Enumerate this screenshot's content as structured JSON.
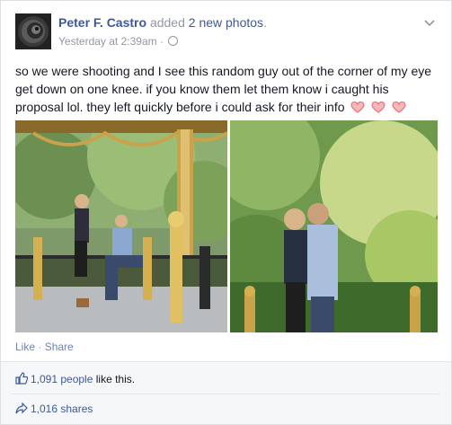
{
  "post": {
    "author": "Peter F. Castro",
    "action_prefix": "added",
    "action_link": "2 new photos",
    "action_suffix": ".",
    "timestamp": "Yesterday at 2:39am",
    "separator": "·",
    "privacy_icon": "globe-icon",
    "menu_icon": "chevron-down-icon",
    "message": "so we were shooting and I see this random guy out of the corner of my eye get down on one knee. if you know them let them know i caught his proposal lol. they left quickly before i could ask for their info",
    "emoji_count": 3,
    "emoji_icon": "heart-icon"
  },
  "actions": {
    "like": "Like",
    "dot": " · ",
    "share": "Share"
  },
  "footer": {
    "likes_count": "1,091 people",
    "likes_suffix": " like this.",
    "shares": "1,016 shares"
  },
  "colors": {
    "link": "#3b5998",
    "muted": "#9197a3",
    "heart": "#e8737a",
    "footer_bg": "#f6f7f9"
  }
}
